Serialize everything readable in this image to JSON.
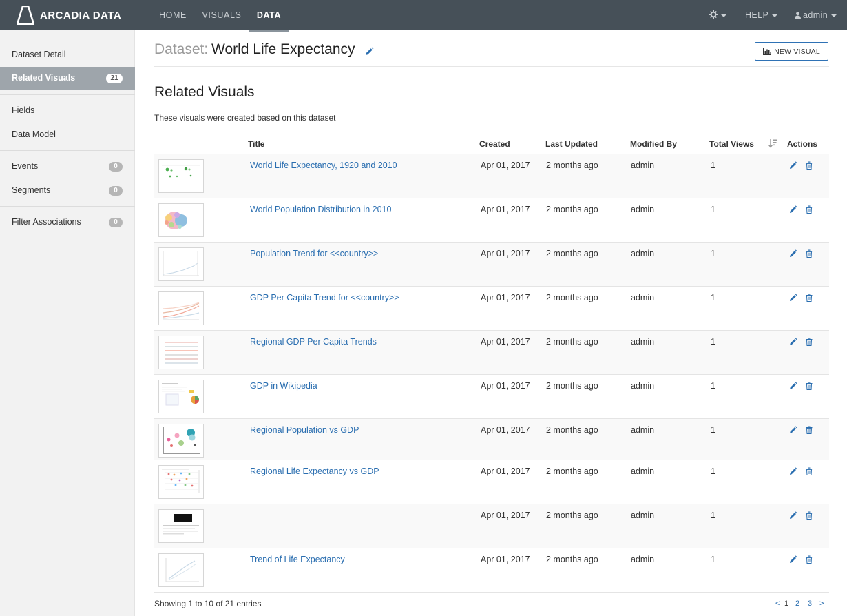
{
  "brand": {
    "name": "ARCADIA DATA"
  },
  "nav": {
    "home": "HOME",
    "visuals": "VISUALS",
    "data": "DATA",
    "help": "HELP",
    "user": "admin"
  },
  "sidebar": {
    "items": [
      {
        "label": "Dataset Detail"
      },
      {
        "label": "Related Visuals",
        "badge": "21"
      },
      {
        "label": "Fields"
      },
      {
        "label": "Data Model"
      },
      {
        "label": "Events",
        "badge": "0"
      },
      {
        "label": "Segments",
        "badge": "0"
      },
      {
        "label": "Filter Associations",
        "badge": "0"
      }
    ]
  },
  "header": {
    "prefix": "Dataset:",
    "title": "World Life Expectancy",
    "new_visual": "NEW VISUAL"
  },
  "section": {
    "title": "Related Visuals",
    "description": "These visuals were created based on this dataset"
  },
  "table": {
    "columns": {
      "title": "Title",
      "created": "Created",
      "updated": "Last Updated",
      "modified_by": "Modified By",
      "views": "Total Views",
      "actions": "Actions"
    },
    "rows": [
      {
        "title": "World Life Expectancy, 1920 and 2010",
        "created": "Apr 01, 2017",
        "updated": "2 months ago",
        "by": "admin",
        "views": "1",
        "thumb": "map"
      },
      {
        "title": "World Population Distribution in 2010",
        "created": "Apr 01, 2017",
        "updated": "2 months ago",
        "by": "admin",
        "views": "1",
        "thumb": "bubbles"
      },
      {
        "title": "Population Trend for <<country>>",
        "created": "Apr 01, 2017",
        "updated": "2 months ago",
        "by": "admin",
        "views": "1",
        "thumb": "line"
      },
      {
        "title": "GDP Per Capita Trend for <<country>>",
        "created": "Apr 01, 2017",
        "updated": "2 months ago",
        "by": "admin",
        "views": "1",
        "thumb": "multiline"
      },
      {
        "title": "Regional GDP Per Capita Trends",
        "created": "Apr 01, 2017",
        "updated": "2 months ago",
        "by": "admin",
        "views": "1",
        "thumb": "strips"
      },
      {
        "title": "GDP in Wikipedia",
        "created": "Apr 01, 2017",
        "updated": "2 months ago",
        "by": "admin",
        "views": "1",
        "thumb": "wiki"
      },
      {
        "title": "Regional Population vs GDP",
        "created": "Apr 01, 2017",
        "updated": "2 months ago",
        "by": "admin",
        "views": "1",
        "thumb": "scatter"
      },
      {
        "title": "Regional Life Expectancy vs GDP",
        "created": "Apr 01, 2017",
        "updated": "2 months ago",
        "by": "admin",
        "views": "1",
        "thumb": "dots"
      },
      {
        "title": "",
        "created": "Apr 01, 2017",
        "updated": "2 months ago",
        "by": "admin",
        "views": "1",
        "thumb": "dark"
      },
      {
        "title": "Trend of Life Expectancy",
        "created": "Apr 01, 2017",
        "updated": "2 months ago",
        "by": "admin",
        "views": "1",
        "thumb": "trend"
      }
    ]
  },
  "footer": {
    "info": "Showing 1 to 10 of 21 entries",
    "prev": "<",
    "pages": [
      "1",
      "2",
      "3"
    ],
    "next": ">"
  },
  "colors": {
    "nav_bg": "#465058",
    "link": "#2a6eb0",
    "sidebar_active": "#9ea5ab"
  }
}
